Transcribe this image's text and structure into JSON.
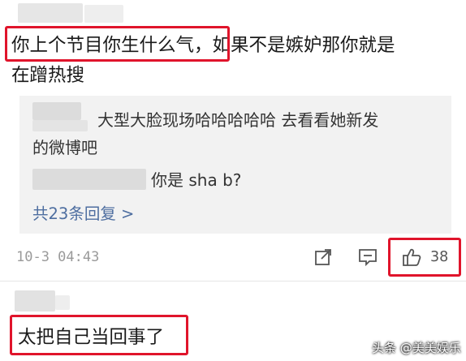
{
  "comment": {
    "highlight": "你上个节目你生什么气，",
    "text_line1_rest": "如果不是嫉妒那你就是",
    "text_line2": "在蹭热搜"
  },
  "replies": [
    {
      "text_line1": "大型大脸现场哈哈哈哈哈 去看看她新发",
      "text_line2": "的微博吧"
    },
    {
      "text": "你是 sha b?"
    }
  ],
  "more_replies": "共23条回复 >",
  "meta": {
    "timestamp": "10-3 04:43",
    "like_count": "38",
    "icons": [
      "share-icon",
      "comment-icon",
      "like-icon"
    ]
  },
  "second_comment": {
    "text": "太把自己当回事了"
  },
  "watermark": "头条 @美美娱乐",
  "colors": {
    "highlight_red": "#e0142b",
    "link_blue": "#4e6ea0",
    "reply_bg": "#f2f2f2"
  }
}
